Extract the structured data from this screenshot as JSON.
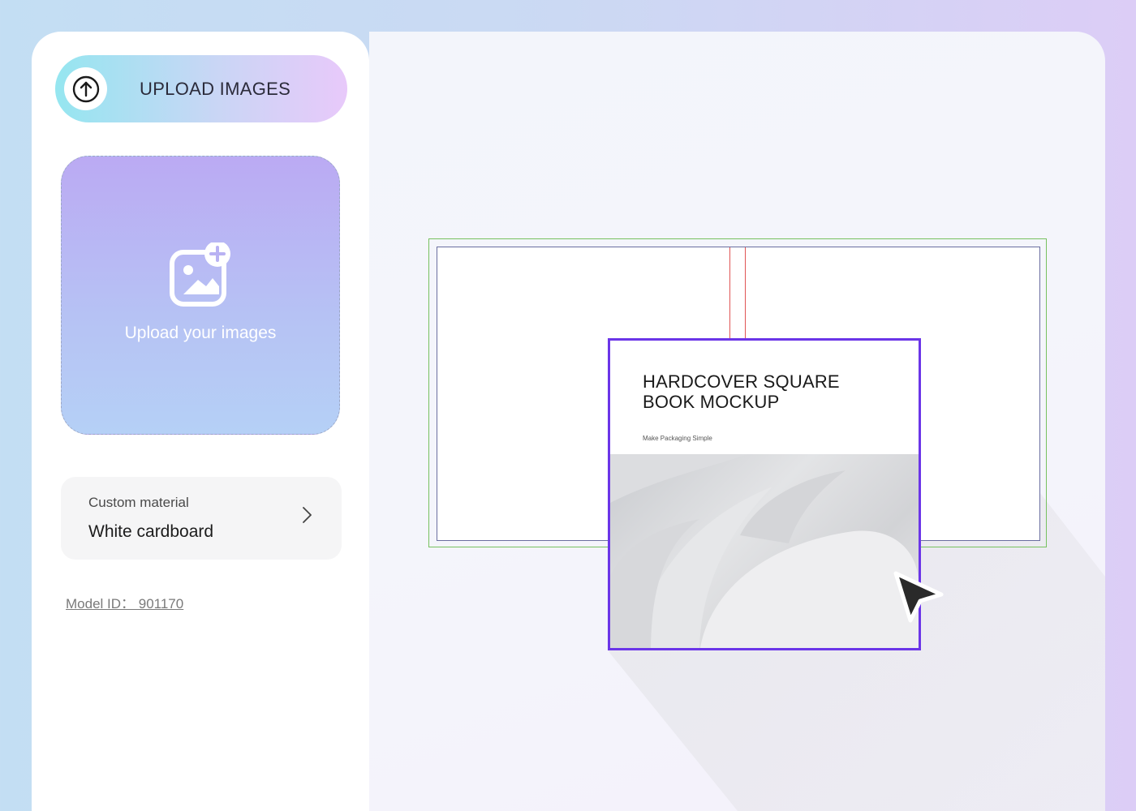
{
  "sidebar": {
    "upload_button_label": "UPLOAD IMAGES",
    "dropzone_text": "Upload your images",
    "material": {
      "label": "Custom material",
      "value": "White cardboard"
    },
    "model_id": "Model ID： 901170"
  },
  "canvas": {
    "cover": {
      "title_line1": "HARDCOVER SQUARE",
      "title_line2": "BOOK MOCKUP",
      "subtitle": "Make Packaging Simple"
    }
  },
  "colors": {
    "selection": "#6b35e8",
    "bleed_line": "#77c160",
    "trim_line": "#6a6ea0",
    "spine_line": "#e05555"
  },
  "icons": {
    "upload": "arrow-up-circle-icon",
    "dropzone": "image-plus-icon",
    "material": "chevron-right-icon",
    "cursor": "cursor-arrow-icon"
  }
}
